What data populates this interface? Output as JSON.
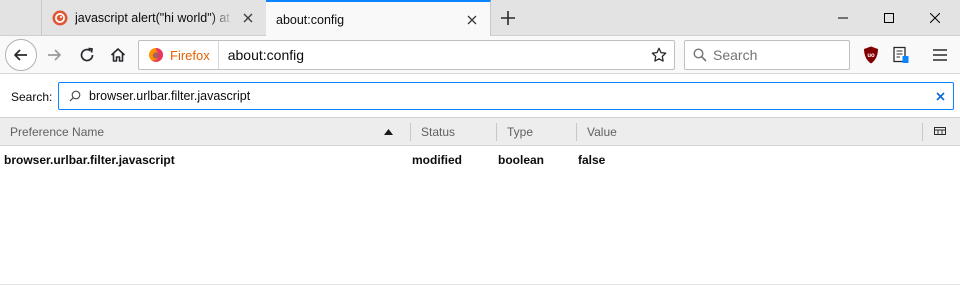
{
  "tabs": [
    {
      "title": "javascript alert(\"hi world\") at Du",
      "active": false,
      "favicon": "duckduckgo-icon"
    },
    {
      "title": "about:config",
      "active": true,
      "favicon": ""
    }
  ],
  "navbar": {
    "identity_label": "Firefox",
    "url": "about:config",
    "search_placeholder": "Search"
  },
  "config_search": {
    "label": "Search:",
    "value": "browser.urlbar.filter.javascript"
  },
  "columns": [
    "Preference Name",
    "Status",
    "Type",
    "Value"
  ],
  "rows": [
    {
      "name": "browser.urlbar.filter.javascript",
      "status": "modified",
      "type": "boolean",
      "value": "false"
    }
  ],
  "colors": {
    "accent": "#0a84ff",
    "firefox_orange": "#e66000",
    "ublock_red": "#800000"
  }
}
